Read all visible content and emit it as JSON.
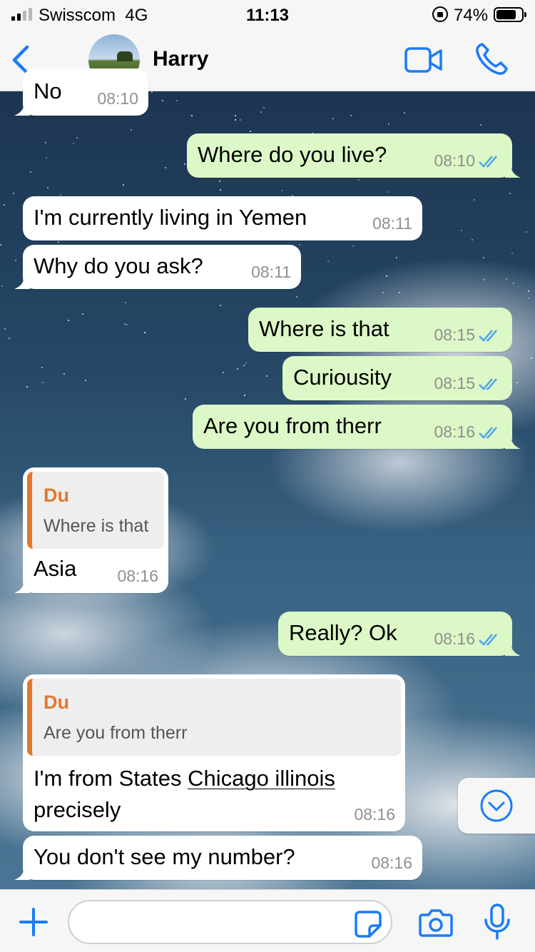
{
  "status_bar": {
    "carrier": "Swisscom",
    "network": "4G",
    "time": "11:13",
    "battery_percent": "74%"
  },
  "header": {
    "contact_name": "Harry",
    "back_icon": "chevron-left-icon",
    "video_icon": "video-camera-icon",
    "call_icon": "phone-icon"
  },
  "colors": {
    "accent": "#1a7cf5",
    "outgoing_bubble": "#dcf8c6",
    "incoming_bubble": "#ffffff",
    "quote_author": "#e2782d",
    "read_ticks": "#4fa7e8"
  },
  "messages": [
    {
      "direction": "in",
      "text": "No",
      "time": "08:10"
    },
    {
      "direction": "out",
      "text": "Where do you live?",
      "time": "08:10",
      "status": "read"
    },
    {
      "direction": "in",
      "text": "I'm currently living in Yemen",
      "time": "08:11"
    },
    {
      "direction": "in",
      "text": "Why do you ask?",
      "time": "08:11"
    },
    {
      "direction": "out",
      "text": "Where is that",
      "time": "08:15",
      "status": "read"
    },
    {
      "direction": "out",
      "text": "Curiousity",
      "time": "08:15",
      "status": "read"
    },
    {
      "direction": "out",
      "text": "Are you from therr",
      "time": "08:16",
      "status": "read"
    },
    {
      "direction": "in",
      "reply_to": {
        "author": "Du",
        "text": "Where is that"
      },
      "text": "Asia",
      "time": "08:16"
    },
    {
      "direction": "out",
      "text": "Really? Ok",
      "time": "08:16",
      "status": "read"
    },
    {
      "direction": "in",
      "reply_to": {
        "author": "Du",
        "text": "Are you from therr"
      },
      "text_before_link": "I'm from States ",
      "link": "Chicago illinois",
      "text_line2": "precisely",
      "time": "08:16"
    },
    {
      "direction": "in",
      "text": "You don't see my number?",
      "time": "08:16"
    }
  ],
  "scroll_button": {
    "icon": "chevron-down-circle-icon"
  },
  "input_bar": {
    "value": "",
    "placeholder": "",
    "plus_icon": "plus-icon",
    "sticker_icon": "sticker-icon",
    "camera_icon": "camera-icon",
    "mic_icon": "microphone-icon"
  }
}
